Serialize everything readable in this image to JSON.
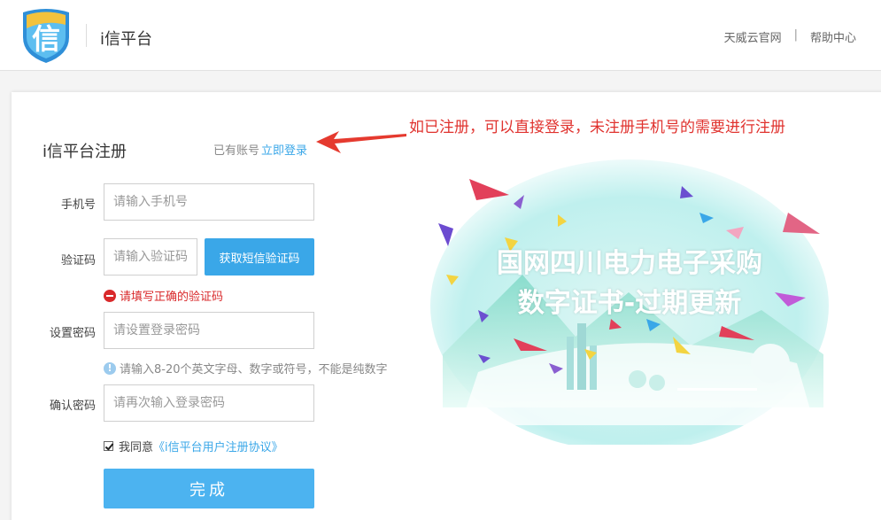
{
  "header": {
    "logo_char": "信",
    "brand": "i信平台",
    "links": [
      "天威云官网",
      "帮助中心"
    ],
    "separator": "|"
  },
  "form": {
    "title": "i信平台注册",
    "has_account": "已有账号",
    "login_link": "立即登录",
    "phone": {
      "label": "手机号",
      "placeholder": "请输入手机号"
    },
    "code": {
      "label": "验证码",
      "placeholder": "请输入验证码",
      "button": "获取短信验证码"
    },
    "code_error": "请填写正确的验证码",
    "password": {
      "label": "设置密码",
      "placeholder": "请设置登录密码"
    },
    "password_hint": "请输入8-20个英文字母、数字或符号，不能是纯数字",
    "confirm": {
      "label": "确认密码",
      "placeholder": "请再次输入登录密码"
    },
    "agree_text": "我同意",
    "agreement_link": "《i信平台用户注册协议》",
    "agree_checked": true,
    "submit": "完成"
  },
  "annotation": "如已注册，可以直接登录，未注册手机号的需要进行注册",
  "banner": {
    "line1": "国网四川电力电子采购",
    "line2": "数字证书-过期更新"
  },
  "colors": {
    "accent": "#3aa7e8",
    "error": "#d9292b",
    "annotation": "#e0322e"
  }
}
